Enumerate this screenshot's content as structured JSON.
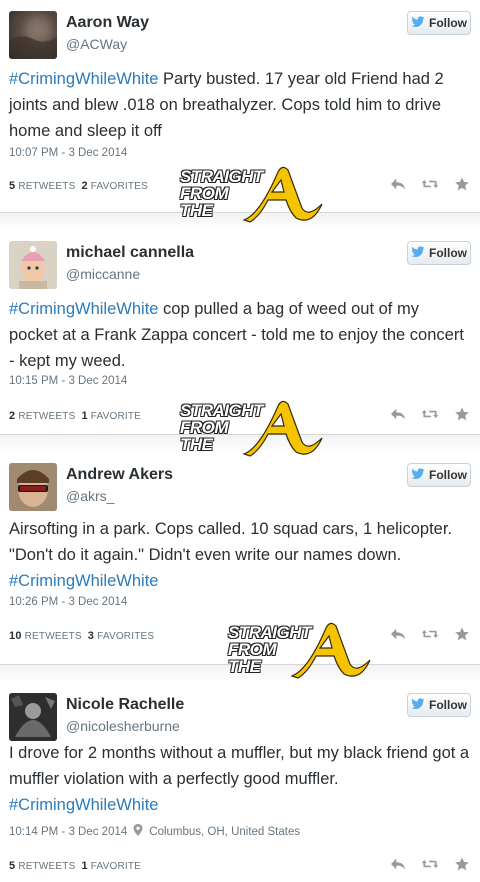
{
  "follow_label": "Follow",
  "watermark": {
    "line1": "STRAIGHT",
    "line2": "FROM",
    "line3": "THE",
    "letter": "A"
  },
  "colors": {
    "hashtag": "#2b7bb9",
    "watermark_gold": "#f5c400"
  },
  "icons": {
    "follow": "twitter-bird-icon",
    "reply": "reply-icon",
    "retweet": "retweet-icon",
    "favorite": "star-icon",
    "location": "location-pin-icon"
  },
  "tweets": [
    {
      "name": "Aaron Way",
      "handle": "@ACWay",
      "hashtag": "#CrimingWhileWhite",
      "text_before": "",
      "text_after": " Party busted. 17 year old Friend had 2 joints and blew .018 on breathalyzer. Cops told him to drive home and sleep it off",
      "time": "10:07 PM - 3 Dec 2014",
      "location": "",
      "retweets": "5",
      "retweets_label": "RETWEETS",
      "favorites": "2",
      "favorites_label": "FAVORITES"
    },
    {
      "name": "michael cannella",
      "handle": "@miccanne",
      "hashtag": "#CrimingWhileWhite",
      "text_before": "",
      "text_after": " cop pulled a bag of weed out of my pocket at a Frank Zappa concert - told me to enjoy the concert - kept my weed.",
      "time": "10:15 PM - 3 Dec 2014",
      "location": "",
      "retweets": "2",
      "retweets_label": "RETWEETS",
      "favorites": "1",
      "favorites_label": "FAVORITE"
    },
    {
      "name": "Andrew Akers",
      "handle": "@akrs_",
      "hashtag": "#CrimingWhileWhite",
      "text_before": "Airsofting in a park. Cops called. 10 squad cars, 1 helicopter. \"Don't do it again.\" Didn't even write our names down. ",
      "text_after": "",
      "time": "10:26 PM - 3 Dec 2014",
      "location": "",
      "retweets": "10",
      "retweets_label": "RETWEETS",
      "favorites": "3",
      "favorites_label": "FAVORITES"
    },
    {
      "name": "Nicole Rachelle",
      "handle": "@nicolesherburne",
      "hashtag": "#CrimingWhileWhite",
      "text_before": "I drove for 2 months without a muffler, but my black friend got a muffler violation with a perfectly good muffler. ",
      "text_after": "",
      "time": "10:14 PM - 3 Dec 2014",
      "location": "Columbus, OH, United States",
      "retweets": "5",
      "retweets_label": "RETWEETS",
      "favorites": "1",
      "favorites_label": "FAVORITE"
    }
  ]
}
